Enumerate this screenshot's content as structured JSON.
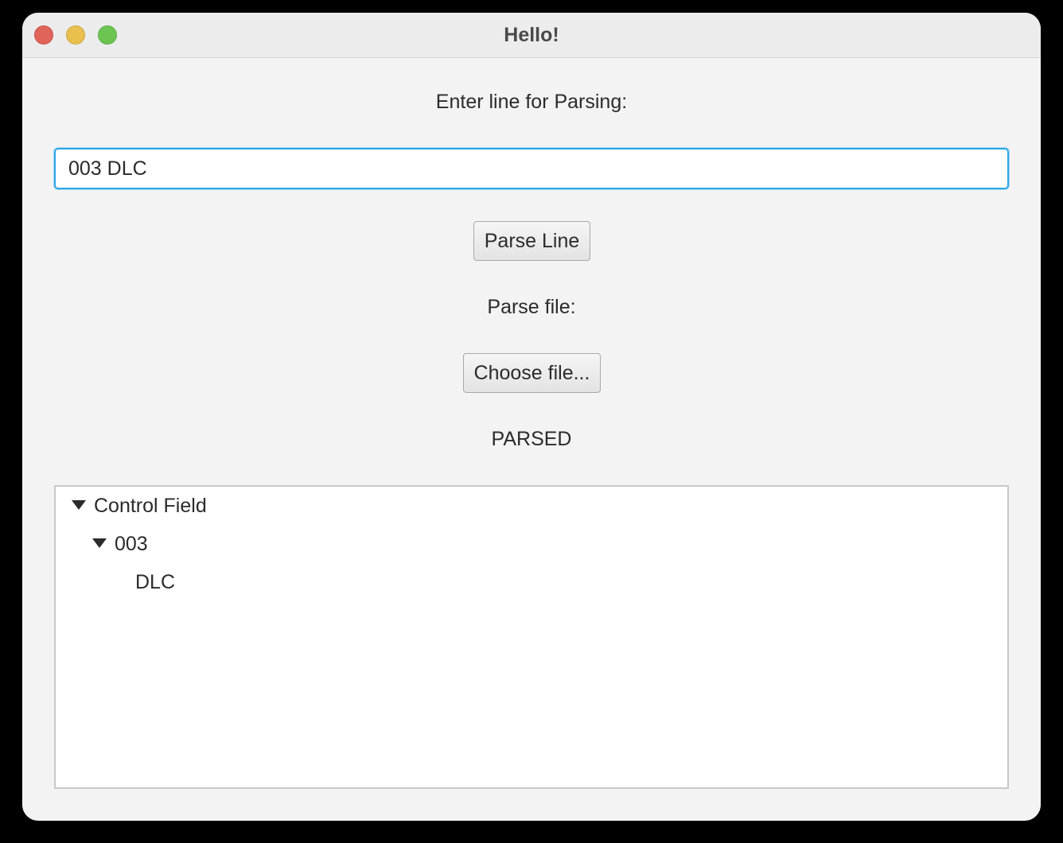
{
  "window": {
    "title": "Hello!",
    "controls": [
      "close",
      "minimize",
      "zoom"
    ]
  },
  "form": {
    "line_label": "Enter line for Parsing:",
    "line_input_value": "003 DLC",
    "parse_line_button": "Parse Line",
    "file_label": "Parse file:",
    "choose_file_button": "Choose file...",
    "status": "PARSED"
  },
  "tree": {
    "root": {
      "label": "Control Field",
      "expanded": true
    },
    "child": {
      "label": "003",
      "expanded": true
    },
    "leaf": {
      "label": "DLC"
    }
  },
  "colors": {
    "window_bg": "#f3f3f3",
    "focus_ring": "#2ea6e6",
    "close": "#e0645a",
    "minimize": "#e9bf4d",
    "zoom": "#6cc552"
  }
}
